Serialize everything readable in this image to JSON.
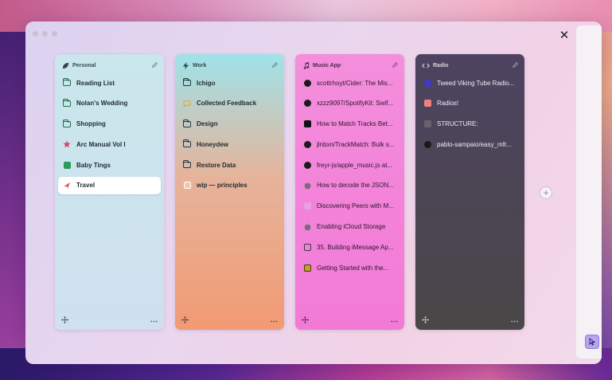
{
  "window": {
    "close_label": "✕"
  },
  "spaces": [
    {
      "id": "personal",
      "title": "Personal",
      "header_icon": "leaf-icon",
      "tabs": [
        {
          "label": "Reading List",
          "icon": "folder-icon",
          "color": "#1f6b4a"
        },
        {
          "label": "Nolan's Wedding",
          "icon": "folder-icon",
          "color": "#1f6b4a"
        },
        {
          "label": "Shopping",
          "icon": "folder-icon",
          "color": "#1f6b4a"
        },
        {
          "label": "Arc Manual Vol I",
          "icon": "star-icon",
          "color": "#d9426b"
        },
        {
          "label": "Baby Tings",
          "icon": "gift-icon",
          "color": "#2e9b5c"
        },
        {
          "label": "Travel",
          "icon": "plane-icon",
          "color": "#e2566a",
          "active": true
        }
      ]
    },
    {
      "id": "work",
      "title": "Work",
      "header_icon": "lightning-icon",
      "tabs": [
        {
          "label": "Ichigo",
          "icon": "folder-icon",
          "color": "#1a3a45"
        },
        {
          "label": "Collected Feedback",
          "icon": "chat-icon",
          "color": "#e9a93a"
        },
        {
          "label": "Design",
          "icon": "folder-icon",
          "color": "#1a3a45"
        },
        {
          "label": "Honeydew",
          "icon": "folder-icon",
          "color": "#1a3a45"
        },
        {
          "label": "Restore Data",
          "icon": "folder-icon",
          "color": "#1a3a45"
        },
        {
          "label": "wip — principles",
          "icon": "doc-icon",
          "color": "#ffffff"
        }
      ]
    },
    {
      "id": "music",
      "title": "Music App",
      "header_icon": "music-note-icon",
      "tabs": [
        {
          "label": "scottrhoyt/Cider: The Mis...",
          "icon": "github-icon",
          "color": "#1a1a1a"
        },
        {
          "label": "xzzz9097/SpotifyKit: Swif...",
          "icon": "github-icon",
          "color": "#1a1a1a"
        },
        {
          "label": "How to Match Tracks Bet...",
          "icon": "video-icon",
          "color": "#1a1a1a"
        },
        {
          "label": "jlnbxn/TrackMatch: Bulk s...",
          "icon": "github-icon",
          "color": "#1a1a1a"
        },
        {
          "label": "freyr-js/apple_music.js at...",
          "icon": "github-icon",
          "color": "#1a1a1a"
        },
        {
          "label": "How to decode the JSON...",
          "icon": "apple-icon",
          "color": "#7a6a7a"
        },
        {
          "label": "Discovering Peers with M...",
          "icon": "square-icon",
          "color": "#e7a0e0"
        },
        {
          "label": "Enabling iCloud Storage",
          "icon": "apple-icon",
          "color": "#7a6a7a"
        },
        {
          "label": "35. Building iMessage Ap...",
          "icon": "book-icon",
          "color": "#3a3a3a"
        },
        {
          "label": "Getting Started with the...",
          "icon": "gem-icon",
          "color": "#c8a020"
        }
      ]
    },
    {
      "id": "radio",
      "title": "Radio",
      "header_icon": "code-icon",
      "tabs": [
        {
          "label": "Tweed Viking Tube Radio...",
          "icon": "k-icon",
          "color": "#3a3ad0"
        },
        {
          "label": "Radios!",
          "icon": "radio-icon",
          "color": "#f08080"
        },
        {
          "label": "STRUCTURE:",
          "icon": "square-icon",
          "color": "#6a6070"
        },
        {
          "label": "pablo-sampaio/easy_mfr...",
          "icon": "github-icon",
          "color": "#1a1a1a"
        }
      ]
    }
  ]
}
